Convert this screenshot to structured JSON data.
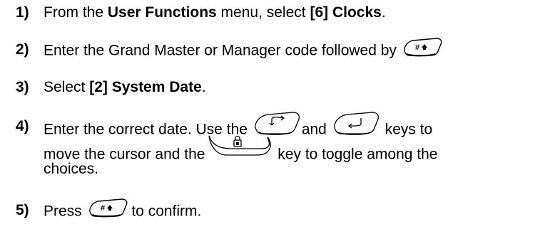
{
  "steps": [
    {
      "num": "1)",
      "t1": "From the ",
      "b1": "User Functions",
      "t2": " menu, select ",
      "b2": "[6] Clocks",
      "t3": "."
    },
    {
      "num": "2)",
      "t1": "Enter the Grand Master or Manager code followed by ",
      "key_icon": "pound-enter-key-icon"
    },
    {
      "num": "3)",
      "t1": "Select ",
      "b1": "[2] System Date",
      "t2": "."
    },
    {
      "num": "4)",
      "l1a": "Enter the correct date. Use the ",
      "l1b": "and",
      "l1c": " keys to",
      "l2a": "move the cursor and the",
      "l2b": " key to toggle among the",
      "l3": "choices.",
      "key_icons": [
        "left-arrow-key-icon",
        "right-arrow-key-icon",
        "lock-key-icon"
      ]
    },
    {
      "num": "5)",
      "t1": "Press ",
      "t2": " to confirm.",
      "key_icon": "pound-enter-key-icon"
    }
  ]
}
